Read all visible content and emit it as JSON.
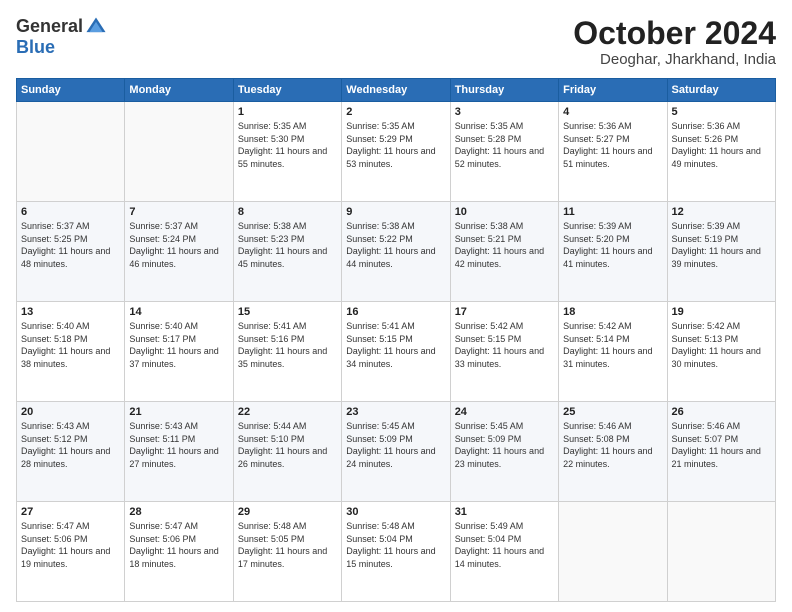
{
  "logo": {
    "general": "General",
    "blue": "Blue"
  },
  "header": {
    "month": "October 2024",
    "location": "Deoghar, Jharkhand, India"
  },
  "days_of_week": [
    "Sunday",
    "Monday",
    "Tuesday",
    "Wednesday",
    "Thursday",
    "Friday",
    "Saturday"
  ],
  "weeks": [
    [
      {
        "day": "",
        "info": ""
      },
      {
        "day": "",
        "info": ""
      },
      {
        "day": "1",
        "info": "Sunrise: 5:35 AM\nSunset: 5:30 PM\nDaylight: 11 hours and 55 minutes."
      },
      {
        "day": "2",
        "info": "Sunrise: 5:35 AM\nSunset: 5:29 PM\nDaylight: 11 hours and 53 minutes."
      },
      {
        "day": "3",
        "info": "Sunrise: 5:35 AM\nSunset: 5:28 PM\nDaylight: 11 hours and 52 minutes."
      },
      {
        "day": "4",
        "info": "Sunrise: 5:36 AM\nSunset: 5:27 PM\nDaylight: 11 hours and 51 minutes."
      },
      {
        "day": "5",
        "info": "Sunrise: 5:36 AM\nSunset: 5:26 PM\nDaylight: 11 hours and 49 minutes."
      }
    ],
    [
      {
        "day": "6",
        "info": "Sunrise: 5:37 AM\nSunset: 5:25 PM\nDaylight: 11 hours and 48 minutes."
      },
      {
        "day": "7",
        "info": "Sunrise: 5:37 AM\nSunset: 5:24 PM\nDaylight: 11 hours and 46 minutes."
      },
      {
        "day": "8",
        "info": "Sunrise: 5:38 AM\nSunset: 5:23 PM\nDaylight: 11 hours and 45 minutes."
      },
      {
        "day": "9",
        "info": "Sunrise: 5:38 AM\nSunset: 5:22 PM\nDaylight: 11 hours and 44 minutes."
      },
      {
        "day": "10",
        "info": "Sunrise: 5:38 AM\nSunset: 5:21 PM\nDaylight: 11 hours and 42 minutes."
      },
      {
        "day": "11",
        "info": "Sunrise: 5:39 AM\nSunset: 5:20 PM\nDaylight: 11 hours and 41 minutes."
      },
      {
        "day": "12",
        "info": "Sunrise: 5:39 AM\nSunset: 5:19 PM\nDaylight: 11 hours and 39 minutes."
      }
    ],
    [
      {
        "day": "13",
        "info": "Sunrise: 5:40 AM\nSunset: 5:18 PM\nDaylight: 11 hours and 38 minutes."
      },
      {
        "day": "14",
        "info": "Sunrise: 5:40 AM\nSunset: 5:17 PM\nDaylight: 11 hours and 37 minutes."
      },
      {
        "day": "15",
        "info": "Sunrise: 5:41 AM\nSunset: 5:16 PM\nDaylight: 11 hours and 35 minutes."
      },
      {
        "day": "16",
        "info": "Sunrise: 5:41 AM\nSunset: 5:15 PM\nDaylight: 11 hours and 34 minutes."
      },
      {
        "day": "17",
        "info": "Sunrise: 5:42 AM\nSunset: 5:15 PM\nDaylight: 11 hours and 33 minutes."
      },
      {
        "day": "18",
        "info": "Sunrise: 5:42 AM\nSunset: 5:14 PM\nDaylight: 11 hours and 31 minutes."
      },
      {
        "day": "19",
        "info": "Sunrise: 5:42 AM\nSunset: 5:13 PM\nDaylight: 11 hours and 30 minutes."
      }
    ],
    [
      {
        "day": "20",
        "info": "Sunrise: 5:43 AM\nSunset: 5:12 PM\nDaylight: 11 hours and 28 minutes."
      },
      {
        "day": "21",
        "info": "Sunrise: 5:43 AM\nSunset: 5:11 PM\nDaylight: 11 hours and 27 minutes."
      },
      {
        "day": "22",
        "info": "Sunrise: 5:44 AM\nSunset: 5:10 PM\nDaylight: 11 hours and 26 minutes."
      },
      {
        "day": "23",
        "info": "Sunrise: 5:45 AM\nSunset: 5:09 PM\nDaylight: 11 hours and 24 minutes."
      },
      {
        "day": "24",
        "info": "Sunrise: 5:45 AM\nSunset: 5:09 PM\nDaylight: 11 hours and 23 minutes."
      },
      {
        "day": "25",
        "info": "Sunrise: 5:46 AM\nSunset: 5:08 PM\nDaylight: 11 hours and 22 minutes."
      },
      {
        "day": "26",
        "info": "Sunrise: 5:46 AM\nSunset: 5:07 PM\nDaylight: 11 hours and 21 minutes."
      }
    ],
    [
      {
        "day": "27",
        "info": "Sunrise: 5:47 AM\nSunset: 5:06 PM\nDaylight: 11 hours and 19 minutes."
      },
      {
        "day": "28",
        "info": "Sunrise: 5:47 AM\nSunset: 5:06 PM\nDaylight: 11 hours and 18 minutes."
      },
      {
        "day": "29",
        "info": "Sunrise: 5:48 AM\nSunset: 5:05 PM\nDaylight: 11 hours and 17 minutes."
      },
      {
        "day": "30",
        "info": "Sunrise: 5:48 AM\nSunset: 5:04 PM\nDaylight: 11 hours and 15 minutes."
      },
      {
        "day": "31",
        "info": "Sunrise: 5:49 AM\nSunset: 5:04 PM\nDaylight: 11 hours and 14 minutes."
      },
      {
        "day": "",
        "info": ""
      },
      {
        "day": "",
        "info": ""
      }
    ]
  ]
}
